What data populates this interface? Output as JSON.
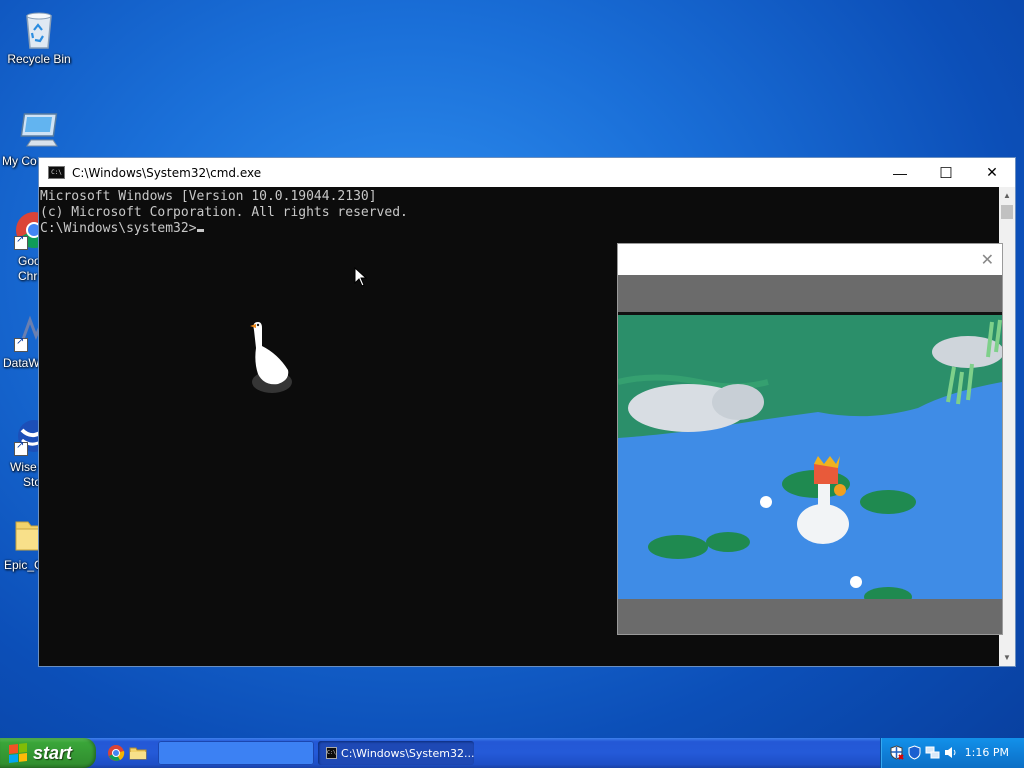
{
  "desktop": {
    "icons": [
      {
        "label": "Recycle Bin"
      },
      {
        "label": "My Co"
      },
      {
        "label_line1": "Goo",
        "label_line2": "Chr"
      },
      {
        "label": "DataW"
      },
      {
        "label_line1": "Wise",
        "label_line2": "Sto"
      },
      {
        "label": "Epic_C"
      }
    ]
  },
  "cmd_window": {
    "title": "C:\\Windows\\System32\\cmd.exe",
    "icon_text": "C:\\",
    "minimize_glyph": "—",
    "maximize_glyph": "☐",
    "close_glyph": "✕",
    "lines": [
      "Microsoft Windows [Version 10.0.19044.2130]",
      "(c) Microsoft Corporation. All rights reserved.",
      "",
      "C:\\Windows\\system32>"
    ]
  },
  "popup": {
    "close_glyph": "✕"
  },
  "taskbar": {
    "start_label": "start",
    "quicklaunch": [
      "chrome-icon",
      "folder-icon",
      "notepad-icon"
    ],
    "cmd_task_label": "C:\\Windows\\System32...",
    "cmd_task_icon_text": "C:\\",
    "clock": "1:16 PM"
  }
}
